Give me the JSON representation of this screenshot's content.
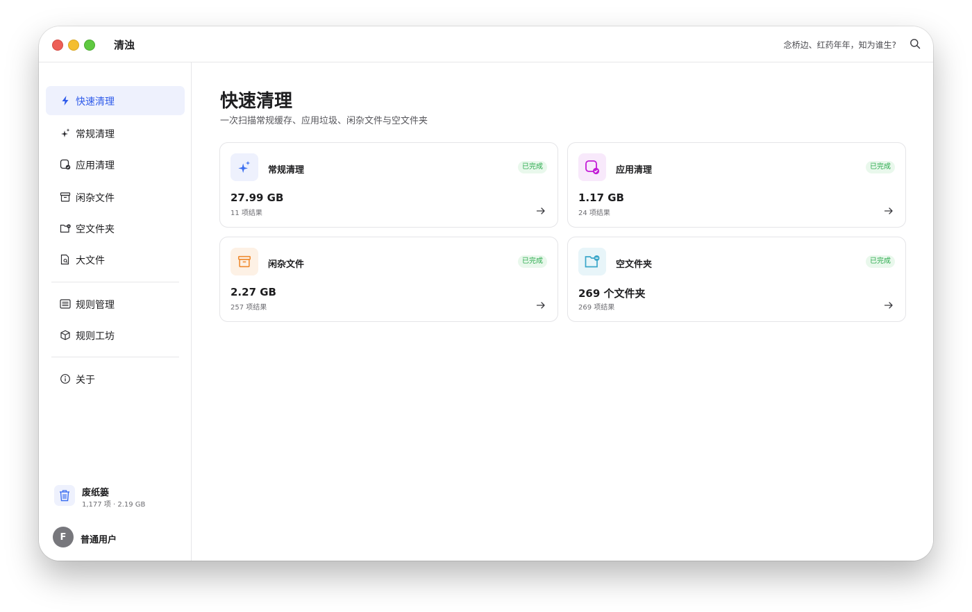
{
  "window": {
    "app_title": "清浊",
    "quote": "念桥边、红药年年，知为谁生?",
    "search_icon": "search-icon"
  },
  "sidebar": {
    "items": [
      {
        "label": "快速清理",
        "icon": "bolt-icon",
        "active": true
      },
      {
        "label": "常规清理",
        "icon": "sparkles-icon"
      },
      {
        "label": "应用清理",
        "icon": "app-check-icon"
      },
      {
        "label": "闲杂文件",
        "icon": "archive-icon"
      },
      {
        "label": "空文件夹",
        "icon": "folder-minus-icon"
      },
      {
        "label": "大文件",
        "icon": "file-search-icon"
      },
      {
        "label": "规则管理",
        "icon": "list-icon"
      },
      {
        "label": "规则工坊",
        "icon": "cube-icon"
      },
      {
        "label": "关于",
        "icon": "info-icon"
      }
    ],
    "trash": {
      "name": "废纸篓",
      "meta": "1,177 项 · 2.19 GB",
      "icon": "trash-icon"
    },
    "user": {
      "avatar_letter": "F",
      "name": "普通用户"
    }
  },
  "main": {
    "title": "快速清理",
    "subtitle": "一次扫描常规缓存、应用垃圾、闲杂文件与空文件夹",
    "cards": [
      {
        "title": "常规清理",
        "status": "已完成",
        "value": "27.99 GB",
        "meta": "11 项结果",
        "icon": "sparkles-icon",
        "accent": "#3b6ef0",
        "icon_bg": "#eef1fd"
      },
      {
        "title": "应用清理",
        "status": "已完成",
        "value": "1.17 GB",
        "meta": "24 项结果",
        "icon": "app-check-icon",
        "accent": "#c21bd6",
        "icon_bg": "#f8e9fb"
      },
      {
        "title": "闲杂文件",
        "status": "已完成",
        "value": "2.27 GB",
        "meta": "257 项结果",
        "icon": "archive-icon",
        "accent": "#ef8a2f",
        "icon_bg": "#fdf1e5"
      },
      {
        "title": "空文件夹",
        "status": "已完成",
        "value": "269 个文件夹",
        "meta": "269 项结果",
        "icon": "folder-minus-icon",
        "accent": "#3aa6c9",
        "icon_bg": "#e8f5f9"
      }
    ]
  },
  "colors": {
    "accent": "#2f5bea",
    "status_green": "#2dab4f",
    "status_green_bg": "#e9f8ec"
  }
}
